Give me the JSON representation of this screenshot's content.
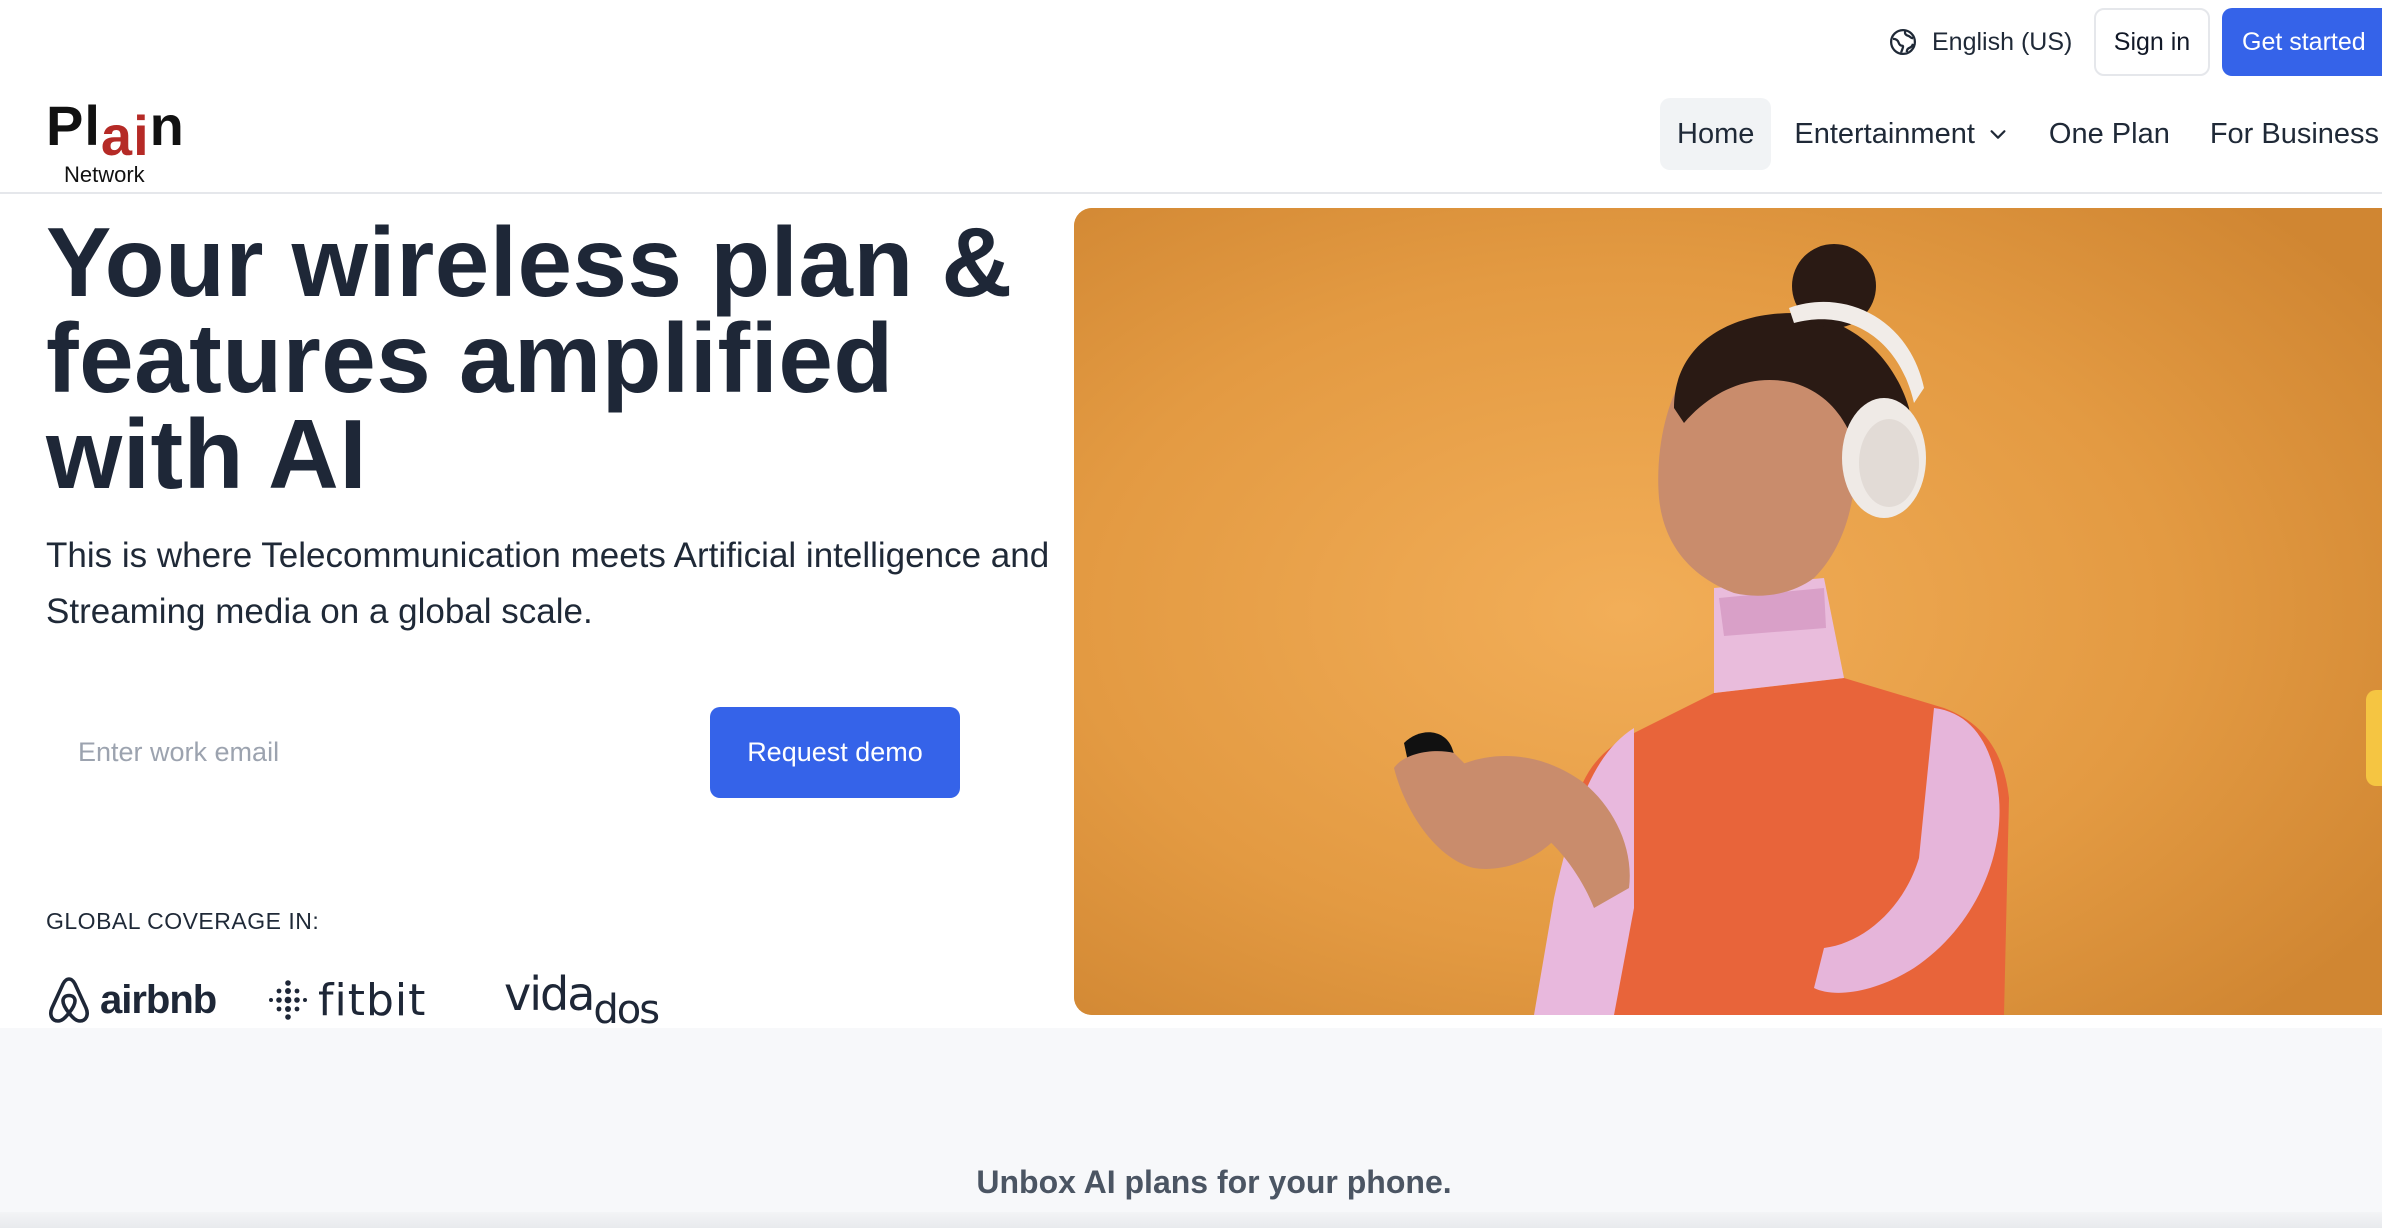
{
  "topbar": {
    "language": "English (US)",
    "sign_in": "Sign in",
    "get_started": "Get started"
  },
  "logo": {
    "part1": "Pl",
    "part2": "ai",
    "part3": "n",
    "sub": "Network"
  },
  "nav": {
    "items": [
      {
        "label": "Home",
        "active": true
      },
      {
        "label": "Entertainment",
        "has_dropdown": true
      },
      {
        "label": "One Plan"
      },
      {
        "label": "For Business"
      }
    ]
  },
  "hero": {
    "title": "Your wireless plan & features amplified with AI",
    "subtitle": "This is where Telecommunication meets Artificial intelligence and Streaming media on a global scale.",
    "email_placeholder": "Enter work email",
    "cta": "Request demo",
    "image_description_icon": "woman-headphones-phone-photo"
  },
  "coverage": {
    "label": "GLOBAL COVERAGE IN:",
    "brands": [
      {
        "name": "airbnb",
        "icon": "airbnb-logo-icon"
      },
      {
        "name": "fitbit",
        "icon": "fitbit-logo-icon"
      },
      {
        "name_part1": "vida",
        "name_part2": "dos",
        "icon": "vidados-logo-icon"
      }
    ]
  },
  "section2": {
    "title": "Unbox AI plans for your phone."
  },
  "colors": {
    "primary": "#3563e9",
    "logo_accent": "#b52a26",
    "hero_bg": "#e49b44",
    "heading": "#1e2737"
  }
}
